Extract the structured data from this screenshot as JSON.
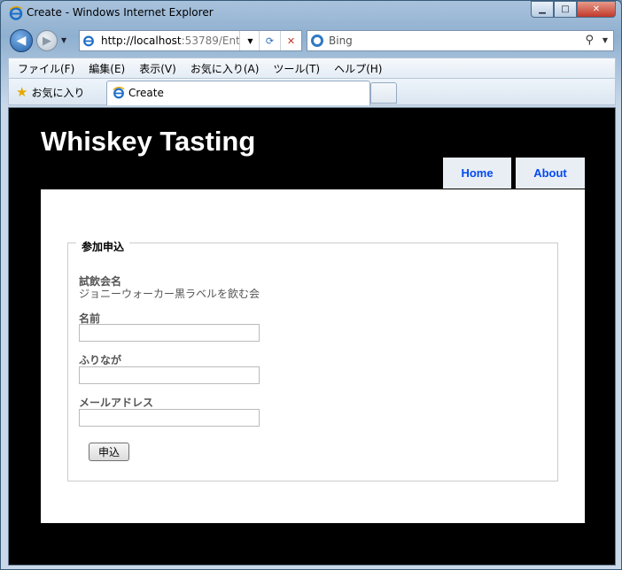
{
  "window": {
    "title": "Create - Windows Internet Explorer",
    "min_glyph": "▁",
    "max_glyph": "□",
    "close_glyph": "✕"
  },
  "navbar": {
    "url_host": "http://localhost",
    "url_rest": ":53789/Ent",
    "search_provider": "Bing"
  },
  "menu": {
    "items": [
      "ファイル(F)",
      "編集(E)",
      "表示(V)",
      "お気に入り(A)",
      "ツール(T)",
      "ヘルプ(H)"
    ]
  },
  "favorites": {
    "label": "お気に入り"
  },
  "tab": {
    "label": "Create"
  },
  "site": {
    "title": "Whiskey Tasting",
    "nav": {
      "home": "Home",
      "about": "About"
    }
  },
  "form": {
    "legend": "参加申込",
    "event_label": "試飲会名",
    "event_value": "ジョニーウォーカー黒ラベルを飲む会",
    "name_label": "名前",
    "name_value": "",
    "furigana_label": "ふりなが",
    "furigana_value": "",
    "email_label": "メールアドレス",
    "email_value": "",
    "submit_label": "申込"
  },
  "colors": {
    "site_background": "#000000",
    "nav_link": "#034af3",
    "nav_tab_bg": "#e8eef4"
  }
}
